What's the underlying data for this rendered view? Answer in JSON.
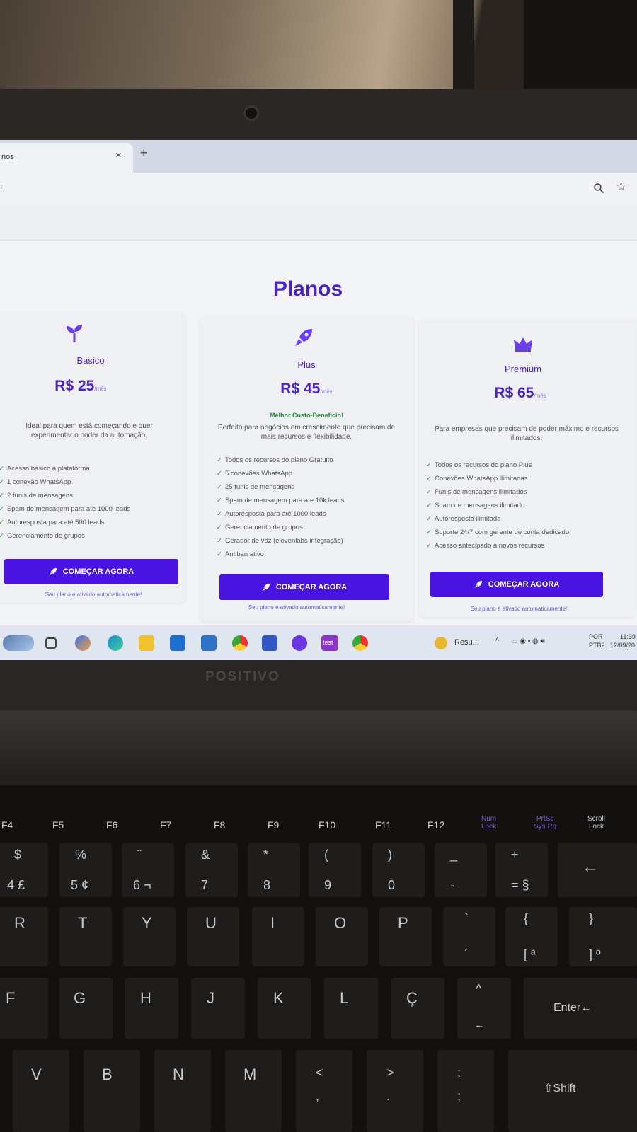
{
  "browser": {
    "tab_title": "nos",
    "tab_close": "×",
    "new_tab": "+",
    "url": "ı",
    "star": "☆"
  },
  "page": {
    "title": "Planos"
  },
  "plans": [
    {
      "icon": "sprout-icon",
      "name": "Basico",
      "price": "R$ 25",
      "period": "/mês",
      "tag": "",
      "description": "Ideal para quem está começando e quer experimentar o poder da automação.",
      "features": [
        "Acesso básico à plataforma",
        "1 conexão WhatsApp",
        "2 funis de mensagens",
        "Spam de mensagem para ate 1000 leads",
        "Autoresposta para até 500 leads",
        "Gerenciamento de grupos"
      ],
      "cta": "COMEÇAR AGORA",
      "note": "Seu plano é ativado automaticamente!"
    },
    {
      "icon": "rocket-icon",
      "name": "Plus",
      "price": "R$ 45",
      "period": "/mês",
      "tag": "Melhor Custo-Benefício!",
      "description": "Perfeito para negócios em crescimento que precisam de mais recursos e flexibilidade.",
      "features": [
        "Todos os recursos do plano Gratuito",
        "5 conexões WhatsApp",
        "25 funis de mensagens",
        "Spam de mensagem para ate 10k leads",
        "Autoresposta para até 1000 leads",
        "Gerenciamento de grupos",
        "Gerador de voz (elevenlabs integração)",
        "Antiban ativo"
      ],
      "cta": "COMEÇAR AGORA",
      "note": "Seu plano é ativado automaticamente!"
    },
    {
      "icon": "crown-icon",
      "name": "Premium",
      "price": "R$ 65",
      "period": "/mês",
      "tag": "",
      "description": "Para empresas que precisam de poder máximo e recursos ilimitados.",
      "features": [
        "Todos os recursos do plano Plus",
        "Conexões WhatsApp ilimitadas",
        "Funis de mensagens ilimitados",
        "Spam de mensagens ilimitado",
        "Autoresposta ilimitada",
        "Suporte 24/7 com gerente de conta dedicado",
        "Acesso antecipado a novos recursos"
      ],
      "cta": "COMEÇAR AGORA",
      "note": "Seu plano é ativado automaticamente!"
    }
  ],
  "taskbar": {
    "test_label": "test",
    "app_label": "Resu...",
    "lang_top": "POR",
    "lang_bottom": "PTB2",
    "time": "11:39",
    "date": "12/09/20"
  },
  "laptop": {
    "brand": "POSITIVO"
  },
  "keyboard": {
    "frow": [
      "F4",
      "F5",
      "F6",
      "F7",
      "F8",
      "F9",
      "F10",
      "F11",
      "F12"
    ],
    "numlock": "Num\nLock",
    "prtsc": "PrtSc\nSys Rq",
    "scroll": "Scroll\nLock",
    "numrow": [
      {
        "top": "$",
        "bottom": "4 £"
      },
      {
        "top": "%",
        "bottom": "5 ¢"
      },
      {
        "top": "¨",
        "bottom": "6 ¬"
      },
      {
        "top": "&",
        "bottom": "7"
      },
      {
        "top": "*",
        "bottom": "8"
      },
      {
        "top": "(",
        "bottom": "9"
      },
      {
        "top": ")",
        "bottom": "0"
      },
      {
        "top": "_",
        "bottom": "-"
      },
      {
        "top": "+",
        "bottom": "= §"
      }
    ],
    "backspace": "←",
    "row2": [
      "R",
      "T",
      "Y",
      "U",
      "I",
      "O",
      "P"
    ],
    "row2_extra": [
      {
        "top": "`",
        "bottom": "´"
      },
      {
        "top": "{",
        "bottom": "[ ª"
      },
      {
        "top": "}",
        "bottom": "] º"
      }
    ],
    "row3": [
      "F",
      "G",
      "H",
      "J",
      "K",
      "L",
      "Ç"
    ],
    "row3_extra": {
      "top": "^",
      "bottom": "~"
    },
    "enter": "Enter←",
    "row4": [
      "V",
      "B",
      "N",
      "M"
    ],
    "row4_extra": [
      {
        "top": "<",
        "bottom": ","
      },
      {
        "top": ">",
        "bottom": "."
      },
      {
        "top": ":",
        "bottom": ";"
      }
    ],
    "shift": "⇧Shift"
  }
}
